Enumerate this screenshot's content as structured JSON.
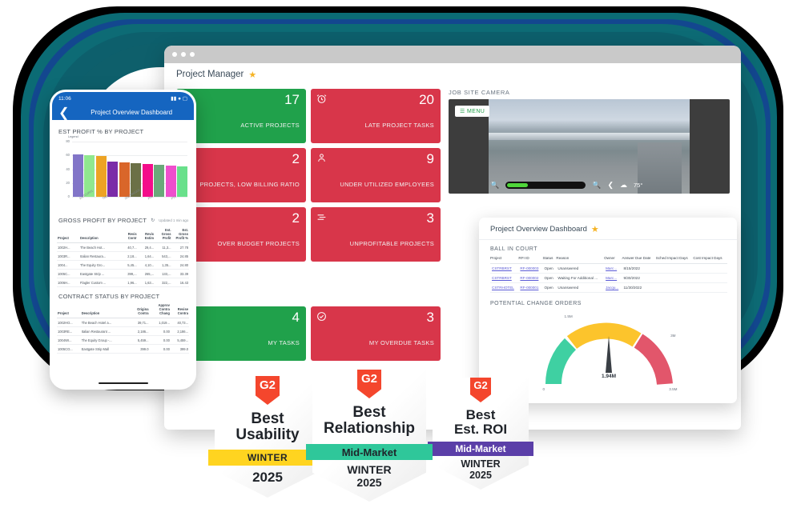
{
  "background": {
    "ring_colors": [
      "#000000",
      "#0b6b74",
      "#13478f",
      "#0d6b75",
      "#0d5f6c"
    ]
  },
  "browser": {
    "app_title": "Project Manager",
    "star_icon": "star-icon",
    "kpis": [
      {
        "value": "17",
        "label": "ACTIVE PROJECTS",
        "color": "#20a14b",
        "icon": "folder-icon"
      },
      {
        "value": "20",
        "label": "LATE PROJECT TASKS",
        "color": "#d8364a",
        "icon": "alarm-clock-icon"
      },
      {
        "value": "2",
        "label": "PROJECTS, LOW BILLING RATIO",
        "color": "#d8364a",
        "icon": "none"
      },
      {
        "value": "9",
        "label": "UNDER UTILIZED EMPLOYEES",
        "color": "#d8364a",
        "icon": "person-icon"
      },
      {
        "value": "2",
        "label": "OVER BUDGET PROJECTS",
        "color": "#d8364a",
        "icon": "none"
      },
      {
        "value": "3",
        "label": "UNPROFITABLE PROJECTS",
        "color": "#d8364a",
        "icon": "layers-icon"
      },
      {
        "value": "4",
        "label": "MY TASKS",
        "color": "#20a14b",
        "icon": "none"
      },
      {
        "value": "3",
        "label": "MY OVERDUE TASKS",
        "color": "#d8364a",
        "icon": "check-circle-icon"
      }
    ],
    "camera": {
      "section_label": "JOB SITE CAMERA",
      "menu_label": "MENU",
      "temperature": "75°",
      "icons": [
        "zoom-out-icon",
        "zoom-in-icon",
        "share-icon",
        "cloud-icon"
      ]
    }
  },
  "dashboard": {
    "title": "Project Overview Dashboard",
    "star_icon": "star-icon",
    "ball_in_court": {
      "title": "BALL IN COURT",
      "columns": [
        "Project",
        "RFI ID",
        "Status",
        "Reason",
        "Owner",
        "Answer Due Date",
        "Sched Impact Days",
        "Cost Impact Days"
      ],
      "rows": [
        {
          "project": "CSTRBRST",
          "rfi_id": "RF-000003",
          "status": "Open",
          "reason": "Unanswered",
          "owner": "Marc...",
          "due": "8/15/2022",
          "sched": "",
          "cost": ""
        },
        {
          "project": "CSTRBRST",
          "rfi_id": "RF-000002",
          "status": "Open",
          "reason": "Waiting For Additional ...",
          "owner": "Marc...",
          "due": "9/30/2022",
          "sched": "",
          "cost": ""
        },
        {
          "project": "CSTRHOTEL",
          "rfi_id": "RF-000001",
          "status": "Open",
          "reason": "Unanswered",
          "owner": "Jacqu...",
          "due": "11/30/2022",
          "sched": "",
          "cost": ""
        }
      ]
    },
    "potential_change_orders": {
      "title": "POTENTIAL CHANGE ORDERS",
      "value_label": "1.94M",
      "min_label": "0",
      "mid_label": "1.5M",
      "high_label": "3M",
      "max_label": "3.5M"
    }
  },
  "phone": {
    "status_time": "11:06",
    "status_icons": [
      "location-arrow-icon",
      "signal-icon",
      "wifi-icon",
      "battery-icon"
    ],
    "back_icon": "chevron-left-icon",
    "nav_title": "Project Overview Dashboard",
    "chart_section_title": "EST PROFIT % BY PROJECT",
    "gross_profit": {
      "title": "GROSS PROFIT BY PROJECT",
      "refresh_icon": "refresh-icon",
      "updated": "Updated 1 min ago",
      "columns": [
        "Project",
        "Description",
        "Revis Contr",
        "Revis Estim",
        "Est. Gross Profit",
        "Est. Gross Profit %"
      ],
      "rows": [
        [
          "1002H...",
          "The Beach Hot...",
          "40,7...",
          "29,4...",
          "11,3...",
          "27.78"
        ],
        [
          "1003R...",
          "Italian Restaura...",
          "2,18...",
          "1,64...",
          "543,...",
          "24.85"
        ],
        [
          "1004...",
          "The Equity Gro...",
          "5,45...",
          "4,10...",
          "1,35...",
          "24.80"
        ],
        [
          "1005C...",
          "Eastgate Strip ...",
          "399,...",
          "265,...",
          "133,...",
          "33.39"
        ],
        [
          "1006H...",
          "Flagler Custom ...",
          "1,96...",
          "1,63...",
          "322,...",
          "16.43"
        ]
      ]
    },
    "contract_status": {
      "title": "CONTRACT STATUS BY PROJECT",
      "columns": [
        "Project",
        "Description",
        "Origina Contra",
        "Approv Contra Chang",
        "Revise Contra"
      ],
      "rows": [
        [
          "1002HO...",
          "The Beach Hotel a...",
          "39,71...",
          "1,019...",
          "40,73..."
        ],
        [
          "1003RE...",
          "Italian Restaurant ...",
          "2,186...",
          "0.00",
          "2,186..."
        ],
        [
          "1004WI...",
          "The Equity Group -...",
          "5,459...",
          "0.00",
          "5,459..."
        ],
        [
          "1005CO...",
          "Eastgate Strip Mall",
          "399.0",
          "0.00",
          "399.0"
        ]
      ]
    }
  },
  "chart_data": {
    "type": "bar",
    "title": "EST PROFIT % BY PROJECT",
    "legend_label": "Legend",
    "xlabel": "",
    "ylabel": "",
    "ylim": [
      0,
      80
    ],
    "yticks": [
      0,
      20,
      40,
      60,
      80
    ],
    "grid": true,
    "legend_position": "top-left",
    "categories": [
      "1007CUR01",
      "0EUREC02",
      "TM03",
      "FIXEDP06",
      "2017PROJ02",
      "P07",
      "P08",
      "P09",
      "P10",
      "P11"
    ],
    "values": [
      61,
      59.8,
      59.6,
      51.5,
      50,
      48.3,
      48,
      46.8,
      45.2,
      44.2
    ],
    "colors": [
      "#8275c8",
      "#90e88f",
      "#eda324",
      "#7b2ba8",
      "#d9662a",
      "#6b7046",
      "#f40d8a",
      "#6aa97a",
      "#ef4fcd",
      "#69e08b"
    ]
  },
  "badges": [
    {
      "mark": "G2",
      "title_line1": "Best",
      "title_line2": "Usability",
      "ribbon": "WINTER",
      "ribbon_color": "#ffd420",
      "year_line1": "2025",
      "year_line2": ""
    },
    {
      "mark": "G2",
      "title_line1": "Best",
      "title_line2": "Relationship",
      "ribbon": "Mid-Market",
      "ribbon_color": "#2fc79a",
      "year_line1": "WINTER",
      "year_line2": "2025"
    },
    {
      "mark": "G2",
      "title_line1": "Best",
      "title_line2": "Est. ROI",
      "ribbon": "Mid-Market",
      "ribbon_color": "#5b3fa8",
      "year_line1": "WINTER",
      "year_line2": "2025"
    }
  ]
}
